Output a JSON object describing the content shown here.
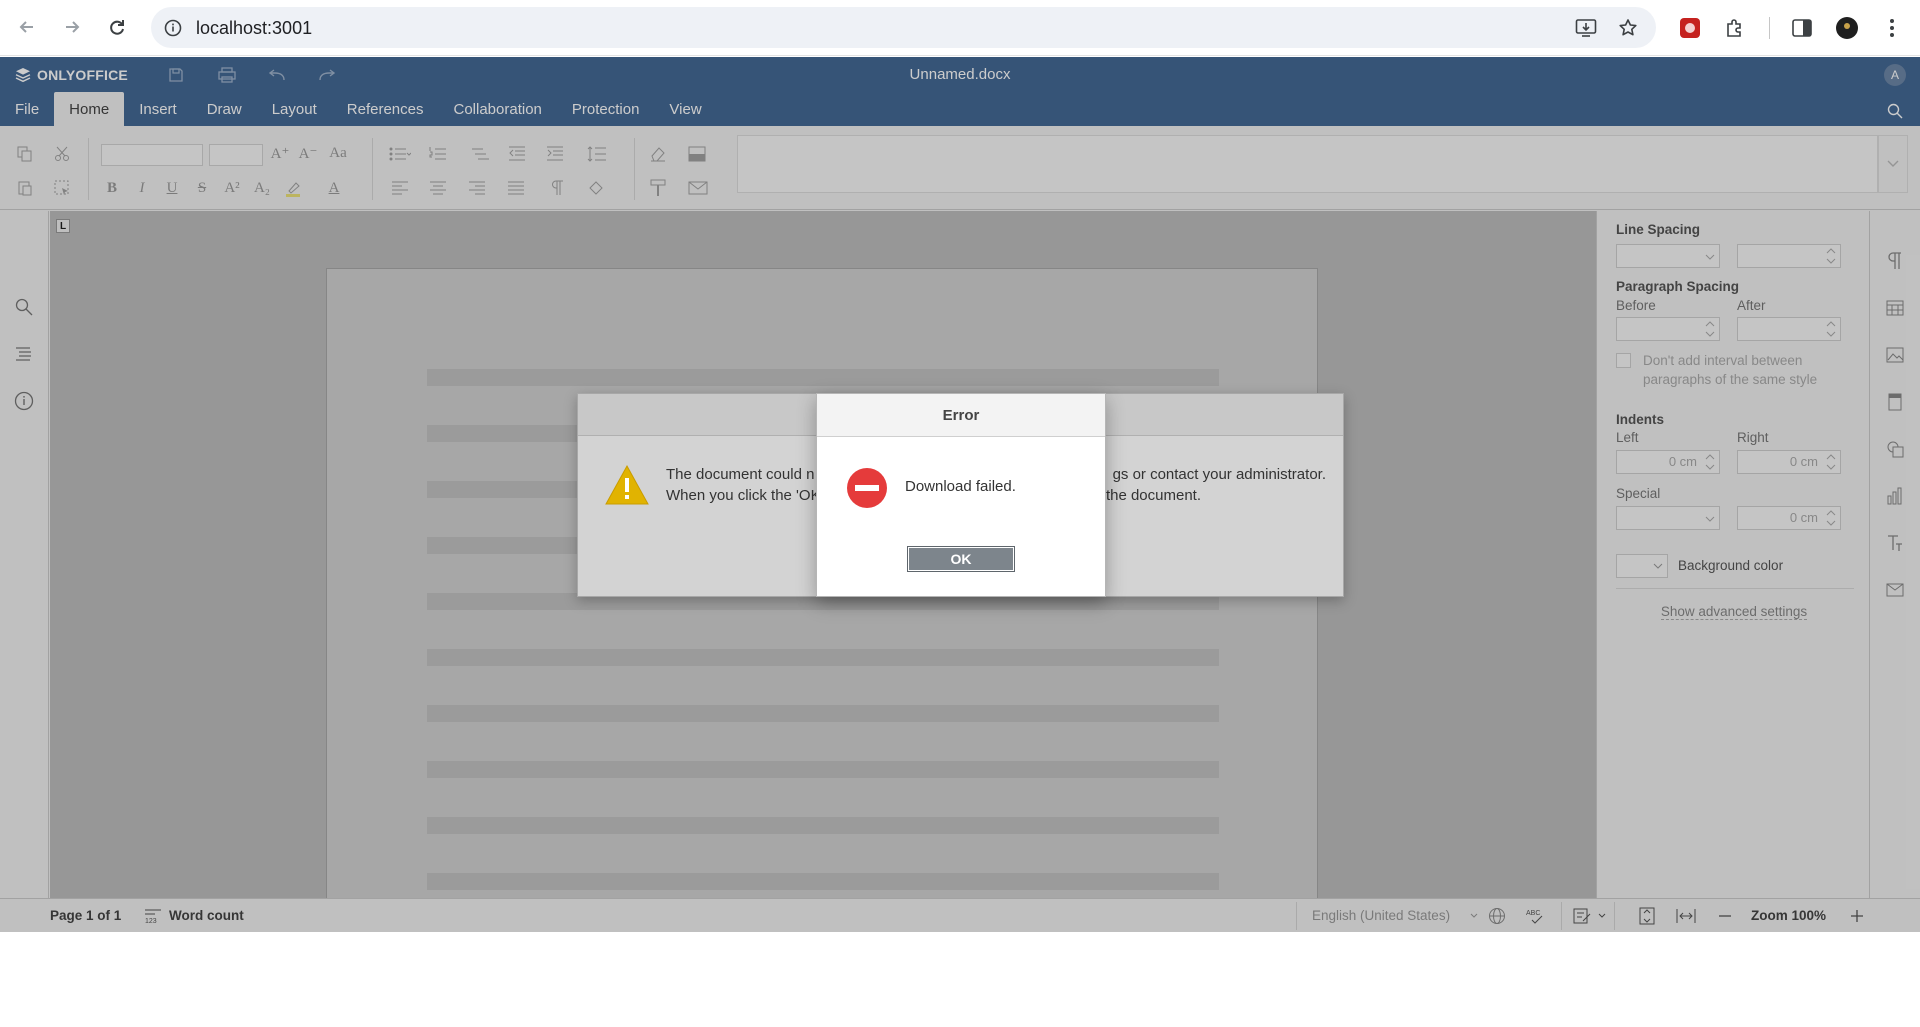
{
  "browser": {
    "url": "localhost:3001"
  },
  "app": {
    "brand": "ONLYOFFICE",
    "document_title": "Unnamed.docx",
    "user_initial": "A",
    "tabs": [
      {
        "label": "File"
      },
      {
        "label": "Home"
      },
      {
        "label": "Insert"
      },
      {
        "label": "Draw"
      },
      {
        "label": "Layout"
      },
      {
        "label": "References"
      },
      {
        "label": "Collaboration"
      },
      {
        "label": "Protection"
      },
      {
        "label": "View"
      }
    ],
    "active_tab": "Home"
  },
  "toolbar": {
    "bold": "B",
    "italic": "I",
    "underline": "U",
    "strike": "S",
    "superscript": "A²",
    "subscript": "A₂",
    "font_color": "A",
    "increase_font": "A⁺",
    "decrease_font": "A⁻",
    "change_case": "Aa"
  },
  "right_panel": {
    "line_spacing_label": "Line Spacing",
    "paragraph_spacing_label": "Paragraph Spacing",
    "before_label": "Before",
    "after_label": "After",
    "dont_add_interval": "Don't add interval between paragraphs of the same style",
    "indents_label": "Indents",
    "left_label": "Left",
    "right_label": "Right",
    "left_value": "0 cm",
    "right_value": "0 cm",
    "special_label": "Special",
    "special_value": "0 cm",
    "background_color_label": "Background color",
    "advanced_settings_link": "Show advanced settings"
  },
  "status_bar": {
    "page_info": "Page 1 of 1",
    "word_count": "Word count",
    "language": "English (United States)",
    "zoom": "Zoom 100%"
  },
  "warning_dialog": {
    "line1_left": "The document could n",
    "line1_right": "gs or contact your administrator.",
    "line2_left": "When you click the 'OK",
    "line2_right": "the document."
  },
  "error_dialog": {
    "title": "Error",
    "message": "Download failed.",
    "ok_label": "OK"
  },
  "colors": {
    "header_blue": "#446995",
    "error_red": "#e53b3b",
    "warning_yellow": "#e5b800"
  }
}
